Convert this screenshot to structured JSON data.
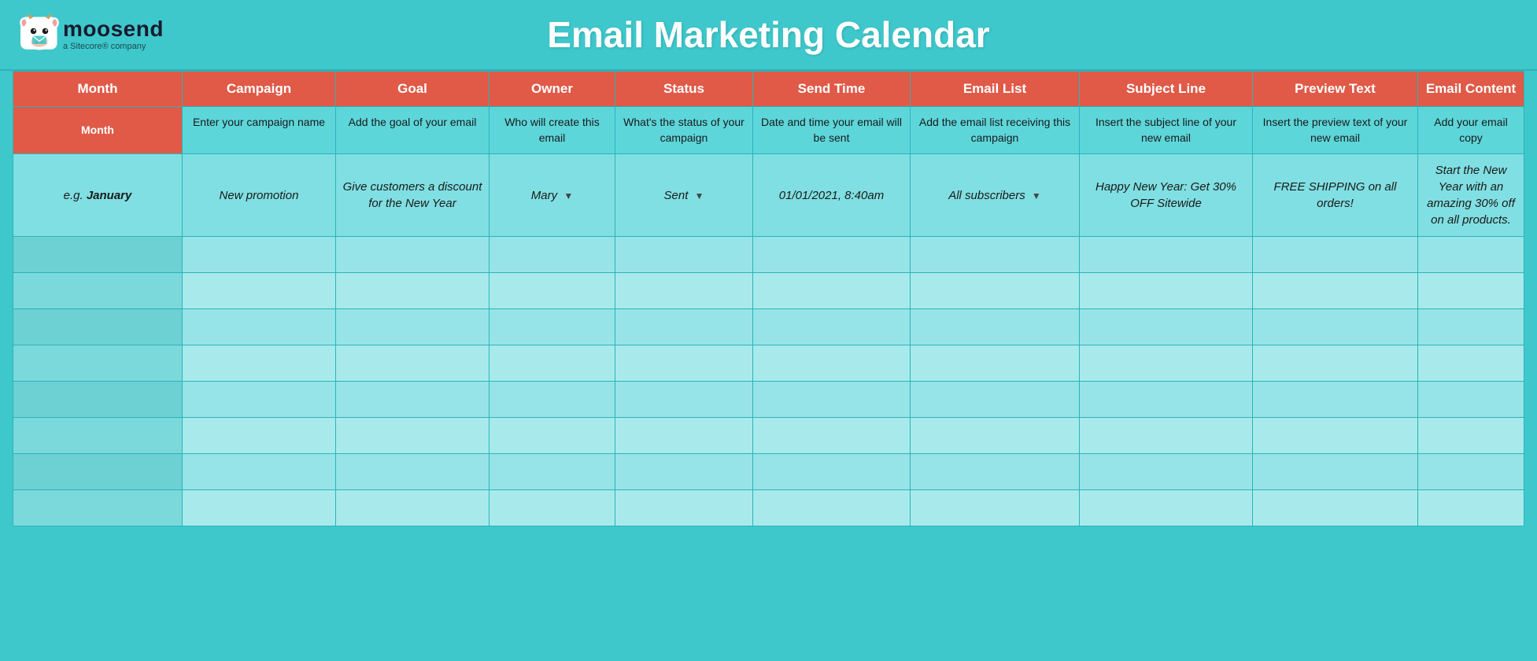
{
  "header": {
    "logo_name": "moosend",
    "logo_tagline": "a Sitecore® company",
    "title": "Email Marketing Calendar"
  },
  "columns": {
    "headers": [
      {
        "id": "month",
        "label": "Month"
      },
      {
        "id": "campaign",
        "label": "Campaign"
      },
      {
        "id": "goal",
        "label": "Goal"
      },
      {
        "id": "owner",
        "label": "Owner"
      },
      {
        "id": "status",
        "label": "Status"
      },
      {
        "id": "sendtime",
        "label": "Send Time"
      },
      {
        "id": "emaillist",
        "label": "Email List"
      },
      {
        "id": "subject",
        "label": "Subject Line"
      },
      {
        "id": "preview",
        "label": "Preview Text"
      },
      {
        "id": "content",
        "label": "Email Content"
      }
    ]
  },
  "desc_row": {
    "month": "Month",
    "campaign": "Enter your campaign name",
    "goal": "Add the goal of your email",
    "owner": "Who will create this email",
    "status": "What's the status of your campaign",
    "sendtime": "Date and time your email will be sent",
    "emaillist": "Add the email list receiving this campaign",
    "subject": "Insert the subject line of your new email",
    "preview": "Insert the preview text of your new email",
    "content": "Add your email copy"
  },
  "example_row": {
    "month": "e.g. January",
    "month_bold": "January",
    "campaign": "New promotion",
    "goal": "Give customers a discount for the New Year",
    "owner": "Mary",
    "status": "Sent",
    "sendtime": "01/01/2021, 8:40am",
    "emaillist": "All subscribers",
    "subject": "Happy New Year: Get 30% OFF Sitewide",
    "preview": "FREE SHIPPING on all orders!",
    "content": "Start the New Year with an amazing 30% off on all products."
  },
  "empty_rows": 8
}
